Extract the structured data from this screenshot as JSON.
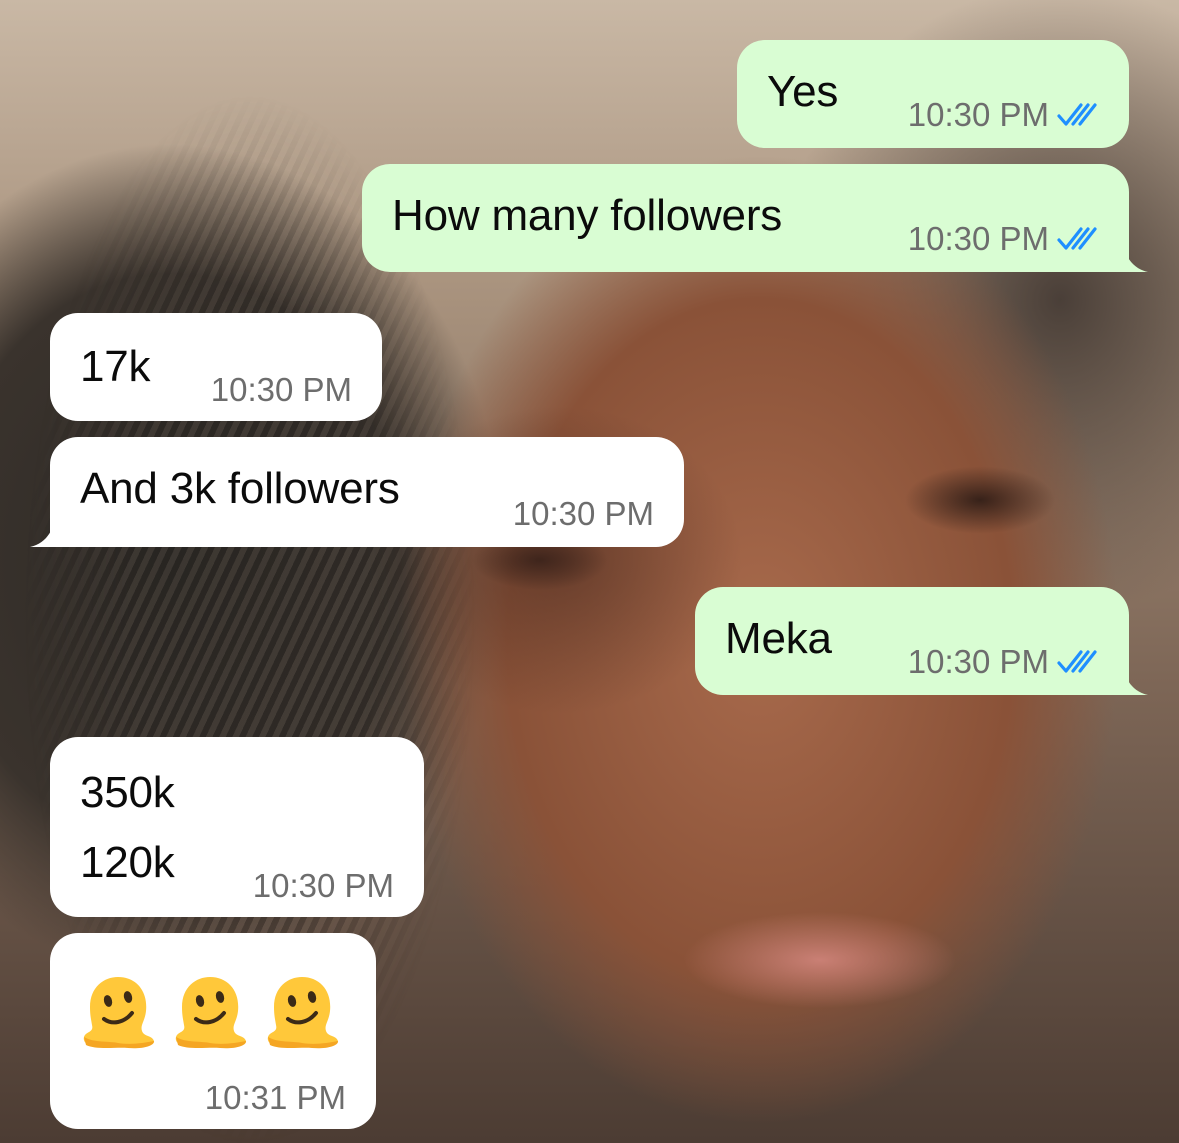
{
  "messages": [
    {
      "direction": "outgoing",
      "text": "Yes",
      "time": "10:30 PM",
      "status_icon": "double-check-read-icon"
    },
    {
      "direction": "outgoing",
      "text": "How many followers",
      "time": "10:30 PM",
      "status_icon": "double-check-read-icon"
    },
    {
      "direction": "incoming",
      "text": "17k",
      "time": "10:30 PM"
    },
    {
      "direction": "incoming",
      "text": "And 3k followers",
      "time": "10:30 PM"
    },
    {
      "direction": "outgoing",
      "text": "Meka",
      "time": "10:30 PM",
      "status_icon": "double-check-read-icon"
    },
    {
      "direction": "incoming",
      "lines": [
        "350k",
        "120k"
      ],
      "time": "10:30 PM"
    },
    {
      "direction": "incoming",
      "emoji": [
        "melting-face-emoji",
        "melting-face-emoji",
        "melting-face-emoji"
      ],
      "time": "10:31 PM"
    }
  ],
  "colors": {
    "outgoing_bubble": "#d9fdd3",
    "incoming_bubble": "#ffffff",
    "read_ticks": "#1f8fff",
    "timestamp": "#6d6d6d"
  }
}
